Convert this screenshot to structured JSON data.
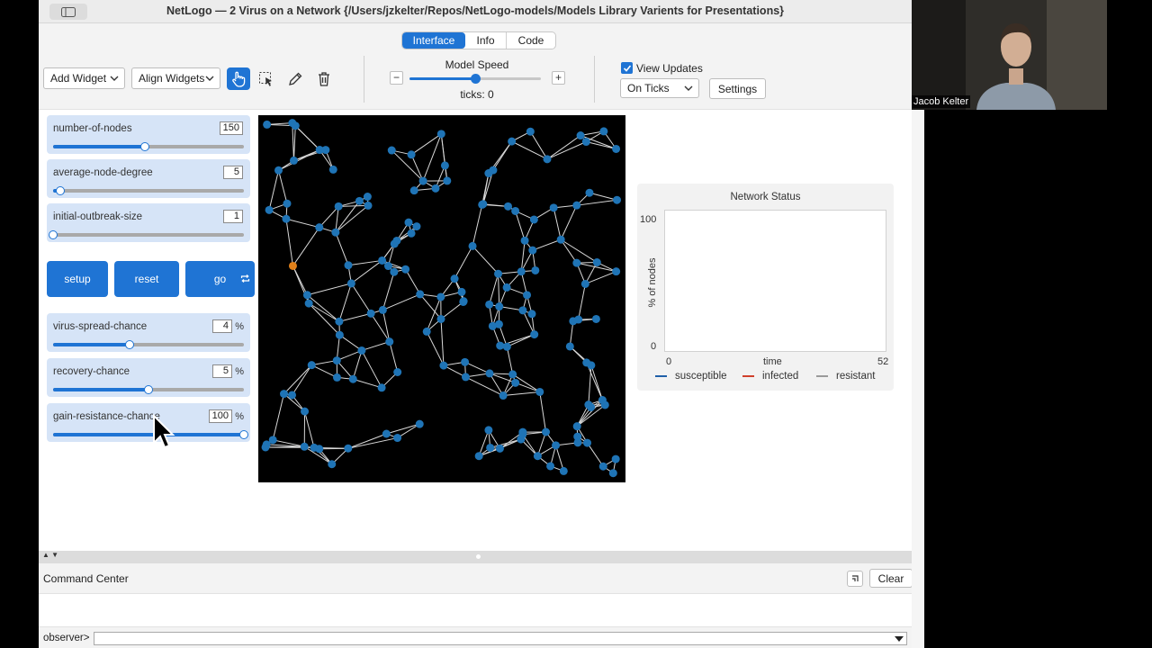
{
  "window": {
    "title": "NetLogo — 2 Virus on a Network {/Users/jzkelter/Repos/NetLogo-models/Models Library Varients for Presentations}"
  },
  "tabs": [
    {
      "label": "Interface",
      "active": true
    },
    {
      "label": "Info",
      "active": false
    },
    {
      "label": "Code",
      "active": false
    }
  ],
  "toolbar": {
    "add_widget": "Add Widget",
    "align_widgets": "Align Widgets",
    "model_speed_label": "Model Speed",
    "model_speed": 0.5,
    "ticks_text": "ticks: 0",
    "view_updates_label": "View Updates",
    "view_updates_checked": true,
    "update_mode": "On Ticks",
    "settings_label": "Settings",
    "tools": [
      "interact-icon",
      "select-icon",
      "edit-icon",
      "delete-icon"
    ]
  },
  "sliders": [
    {
      "label": "number-of-nodes",
      "value": "150",
      "unit": "",
      "fraction": 0.48
    },
    {
      "label": "average-node-degree",
      "value": "5",
      "unit": "",
      "fraction": 0.04
    },
    {
      "label": "initial-outbreak-size",
      "value": "1",
      "unit": "",
      "fraction": 0.0
    },
    {
      "label": "virus-spread-chance",
      "value": "4",
      "unit": "%",
      "fraction": 0.4
    },
    {
      "label": "recovery-chance",
      "value": "5",
      "unit": "%",
      "fraction": 0.5
    },
    {
      "label": "gain-resistance-chance",
      "value": "100",
      "unit": "%",
      "fraction": 1.0
    }
  ],
  "buttons": {
    "setup": "setup",
    "reset": "reset",
    "go": "go"
  },
  "plot": {
    "title": "Network Status",
    "ylabel": "% of nodes",
    "xlabel": "time",
    "ymin": "0",
    "ymax": "100",
    "xmin": "0",
    "xmax": "52",
    "legend": [
      {
        "name": "susceptible",
        "color": "#1f5fa8"
      },
      {
        "name": "infected",
        "color": "#d0402b"
      },
      {
        "name": "resistant",
        "color": "#9a9a9a"
      }
    ]
  },
  "command_center": {
    "title": "Command Center",
    "clear_label": "Clear",
    "prompt": "observer>",
    "input_value": ""
  },
  "video": {
    "participant_name": "Jacob Kelter"
  },
  "network": {
    "node_color": "#1f74b6",
    "infected_color": "#e0801a",
    "link_color": "#d9d9d9"
  }
}
